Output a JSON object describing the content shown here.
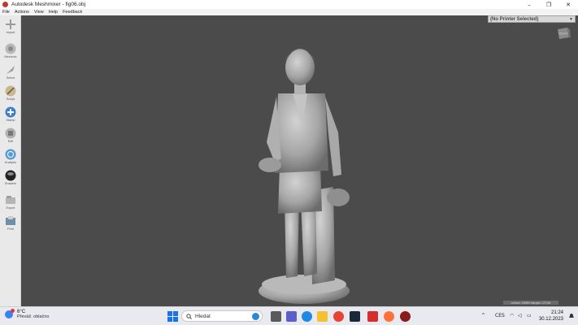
{
  "window": {
    "title": "Autodesk Meshmixer - fig06.obj",
    "buttons": [
      "–",
      "❐",
      "✕"
    ]
  },
  "menu": [
    "File",
    "Actions",
    "View",
    "Help",
    "Feedback"
  ],
  "tools": [
    {
      "label": "Import",
      "icon": "import-icon"
    },
    {
      "label": "Meshmix",
      "icon": "meshmix-icon"
    },
    {
      "label": "Select",
      "icon": "select-icon"
    },
    {
      "label": "Sculpt",
      "icon": "sculpt-icon"
    },
    {
      "label": "Stamp",
      "icon": "stamp-icon"
    },
    {
      "label": "Edit",
      "icon": "edit-icon"
    },
    {
      "label": "Analysis",
      "icon": "analysis-icon"
    },
    {
      "label": "Shaders",
      "icon": "shaders-icon"
    },
    {
      "label": "Export",
      "icon": "export-icon"
    },
    {
      "label": "Print",
      "icon": "print-icon"
    }
  ],
  "viewport": {
    "printer_selector": "(No Printer Selected)",
    "viewcube_label": "RIGHT",
    "status": "vertices: 108594 triangles: 217184"
  },
  "taskbar": {
    "weather_temp": "6°C",
    "weather_desc": "Převáž. oblačno",
    "search_placeholder": "Hledat",
    "language": "CES",
    "time": "21:24",
    "date": "30.12.2023"
  },
  "colors": {
    "viewport_bg": "#4b4b4b",
    "taskbar_bg": "#e8eaf0",
    "model_gray": "#a9a9a9"
  }
}
